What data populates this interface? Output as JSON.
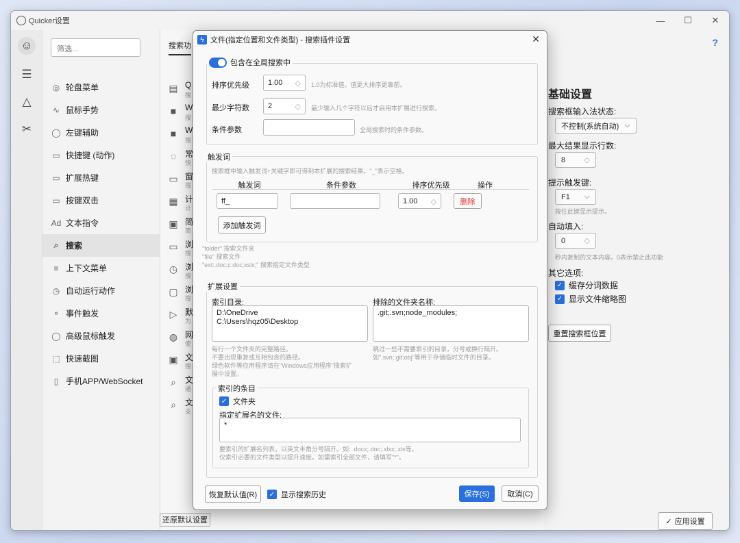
{
  "window": {
    "title": "Quicker设置"
  },
  "filter": {
    "placeholder": "筛选..."
  },
  "nav": {
    "items": [
      {
        "label": "轮盘菜单",
        "icon": "wheel-icon"
      },
      {
        "label": "鼠标手势",
        "icon": "gesture-icon"
      },
      {
        "label": "左键辅助",
        "icon": "mouse-icon"
      },
      {
        "label": "快捷键 (动作)",
        "icon": "keyboard-icon"
      },
      {
        "label": "扩展热键",
        "icon": "keyboard-icon"
      },
      {
        "label": "按键双击",
        "icon": "keyboard-icon"
      },
      {
        "label": "文本指令",
        "icon": "text-icon"
      },
      {
        "label": "搜索",
        "icon": "search-icon"
      },
      {
        "label": "上下文菜单",
        "icon": "menu-icon"
      },
      {
        "label": "自动运行动作",
        "icon": "clock-icon"
      },
      {
        "label": "事件触发",
        "icon": "event-icon"
      },
      {
        "label": "高级鼠标触发",
        "icon": "mouse-icon"
      },
      {
        "label": "快速截图",
        "icon": "screenshot-icon"
      },
      {
        "label": "手机APP/WebSocket",
        "icon": "phone-icon"
      }
    ]
  },
  "mid": {
    "tab_label": "搜索功",
    "rows": [
      {
        "t1": "Q",
        "t2": "搜"
      },
      {
        "t1": "W",
        "t2": "搜"
      },
      {
        "t1": "W",
        "t2": "搜"
      },
      {
        "t1": "常",
        "t2": "快"
      },
      {
        "t1": "窗",
        "t2": "搜"
      },
      {
        "t1": "计",
        "t2": "计"
      },
      {
        "t1": "简",
        "t2": "简"
      },
      {
        "t1": "浏",
        "t2": "搜"
      },
      {
        "t1": "浏",
        "t2": "搜"
      },
      {
        "t1": "浏",
        "t2": "搜"
      },
      {
        "t1": "默",
        "t2": "为"
      },
      {
        "t1": "网",
        "t2": "使"
      },
      {
        "t1": "文",
        "t2": "搜"
      },
      {
        "t1": "文",
        "t2": "通"
      },
      {
        "t1": "文",
        "t2": "支"
      }
    ],
    "restore_label": "还原默认设置"
  },
  "right": {
    "heading": "基础设置",
    "ime_label": "搜索框输入法状态:",
    "ime_value": "不控制(系统自动)",
    "max_rows_label": "最大结果显示行数:",
    "max_rows_value": "8",
    "hint_key_label": "提示触发键:",
    "hint_key_value": "F1",
    "hint_key_hint": "按住此键显示提示。",
    "autofill_label": "自动填入:",
    "autofill_value": "0",
    "autofill_hint": "秒内复制的文本内容。0表示禁止此功能",
    "other_label": "其它选项:",
    "opt1": "缓存分词数据",
    "opt2": "显示文件缩略图",
    "reset_pos": "重置搜索框位置",
    "apply": "应用设置",
    "help": "?"
  },
  "dialog": {
    "title": "文件(指定位置和文件类型) - 搜索插件设置",
    "include_global": "包含在全局搜索中",
    "priority_label": "排序优先级",
    "priority_value": "1.00",
    "priority_hint": "1.0为标准值。值更大排序更靠前。",
    "minchars_label": "最少字符数",
    "minchars_value": "2",
    "minchars_hint": "最少输入几个字符以后才启用本扩展进行搜索。",
    "cond_label": "条件参数",
    "cond_hint": "全局搜索时的条件参数。",
    "trigger_legend": "触发词",
    "trigger_hint": "搜索框中输入触发词+关键字即可得到本扩展的搜索结果。\"_\"表示空格。",
    "col_trigger": "触发词",
    "col_cond": "条件参数",
    "col_priority": "排序优先级",
    "col_op": "操作",
    "trigger_value": "ff_",
    "trigger_priority": "1.00",
    "delete": "删除",
    "add_trigger": "添加触发词",
    "usage1": "\"folder\" 搜索文件夹",
    "usage2": "\"file\" 搜索文件",
    "usage3": "\"ext:.doc;c.doc;xslx;\" 搜索指定文件类型",
    "ext_legend": "扩展设置",
    "index_dir_label": "索引目录:",
    "index_dir_value": "D:\\OneDrive\nC:\\Users\\hqz05\\Desktop",
    "excl_label": "排除的文件夹名称:",
    "excl_value": ".git;.svn;node_modules;",
    "index_dir_hint": "每行一个文件夹的完整路径。\n不要出现重复或互相包含的路径。\n绿色软件等应用程序请在\"Windows应用程序\"搜索扩\n展中设置。",
    "excl_hint": "跳过一些不需要索引的目录，分号或换行隔开。\n如\".svn;.git;obj\"等用于存储临时文件的目录。",
    "items_legend": "索引的条目",
    "folder_chk": "文件夹",
    "ext_files_label": "指定扩展名的文件:",
    "ext_files_value": "*",
    "ext_files_hint": "要索引的扩展名列表，以英文半角分号隔开。如: .docx;.doc;.xlsx;.xls等。\n仅索引必要的文件类型以提升速度。如需索引全部文件，请填写\"*\"。",
    "restore_default": "恢复默认值(R)",
    "show_history": "显示搜索历史",
    "save": "保存(S)",
    "cancel": "取消(C)"
  },
  "colors": {
    "accent": "#2a6fdb",
    "danger": "#e03030"
  }
}
